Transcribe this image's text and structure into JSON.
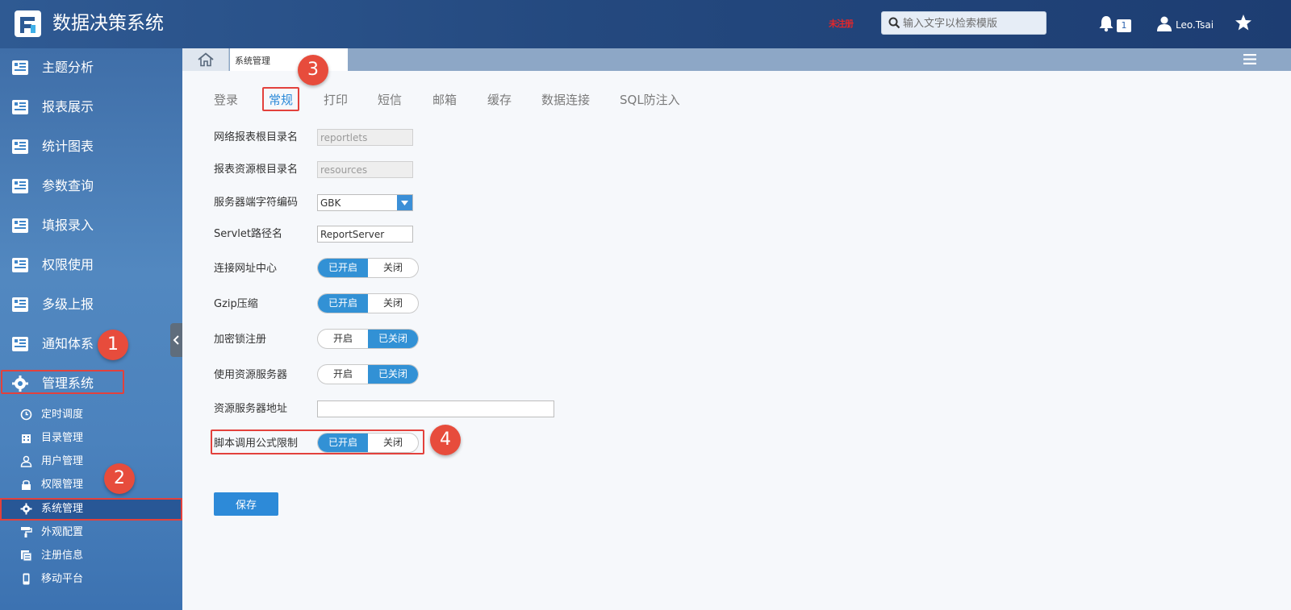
{
  "header": {
    "app_title": "数据决策系统",
    "unregistered_label": "未注册",
    "search_placeholder": "输入文字以检索模版",
    "notification_count": "1",
    "user_name": "Leo.Tsai"
  },
  "tabs": {
    "home_icon": "home-icon",
    "open_tab": "系统管理"
  },
  "sidebar": {
    "items": [
      {
        "label": "主题分析",
        "icon": "report-icon"
      },
      {
        "label": "报表展示",
        "icon": "report-icon"
      },
      {
        "label": "统计图表",
        "icon": "report-icon"
      },
      {
        "label": "参数查询",
        "icon": "report-icon"
      },
      {
        "label": "填报录入",
        "icon": "report-icon"
      },
      {
        "label": "权限使用",
        "icon": "report-icon"
      },
      {
        "label": "多级上报",
        "icon": "report-icon"
      },
      {
        "label": "通知体系",
        "icon": "report-icon"
      },
      {
        "label": "管理系统",
        "icon": "gear-icon"
      }
    ],
    "subitems": [
      {
        "label": "定时调度",
        "icon": "clock-icon"
      },
      {
        "label": "目录管理",
        "icon": "building-icon"
      },
      {
        "label": "用户管理",
        "icon": "user-icon"
      },
      {
        "label": "权限管理",
        "icon": "lock-icon"
      },
      {
        "label": "系统管理",
        "icon": "gear-icon"
      },
      {
        "label": "外观配置",
        "icon": "paint-roller-icon"
      },
      {
        "label": "注册信息",
        "icon": "register-icon"
      },
      {
        "label": "移动平台",
        "icon": "mobile-icon"
      }
    ]
  },
  "subtabs": [
    "登录",
    "常规",
    "打印",
    "短信",
    "邮箱",
    "缓存",
    "数据连接",
    "SQL防注入"
  ],
  "form": {
    "web_report_root_label": "网络报表根目录名",
    "web_report_root_value": "reportlets",
    "report_resource_root_label": "报表资源根目录名",
    "report_resource_root_value": "resources",
    "server_charset_label": "服务器端字符编码",
    "server_charset_value": "GBK",
    "servlet_path_label": "Servlet路径名",
    "servlet_path_value": "ReportServer",
    "connect_center_label": "连接网址中心",
    "connect_center_on": "已开启",
    "connect_center_off": "关闭",
    "gzip_label": "Gzip压缩",
    "gzip_on": "已开启",
    "gzip_off": "关闭",
    "dongle_label": "加密锁注册",
    "dongle_on": "开启",
    "dongle_off": "已关闭",
    "resource_server_label": "使用资源服务器",
    "resource_server_on": "开启",
    "resource_server_off": "已关闭",
    "resource_server_addr_label": "资源服务器地址",
    "resource_server_addr_value": "",
    "script_formula_label": "脚本调用公式限制",
    "script_formula_on": "已开启",
    "script_formula_off": "关闭",
    "save_label": "保存"
  },
  "annotations": [
    "1",
    "2",
    "3",
    "4"
  ],
  "colors": {
    "accent": "#2d8ad8",
    "highlight": "#e3413c",
    "badge": "#e74c3c"
  }
}
